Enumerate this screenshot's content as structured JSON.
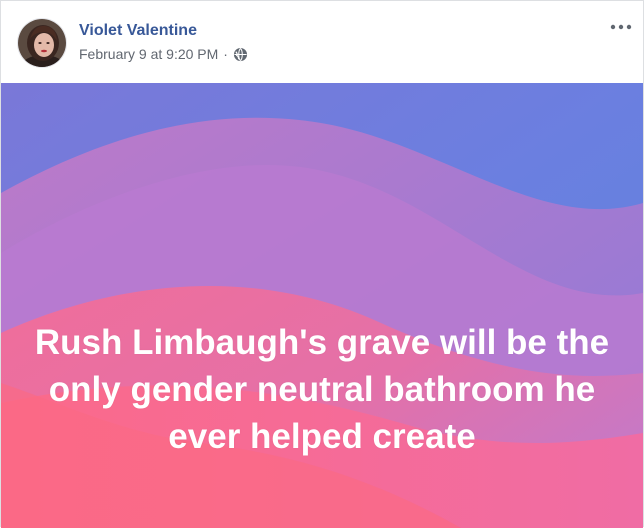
{
  "post": {
    "author": "Violet Valentine",
    "date": "February 9 at 9:20 PM",
    "separator": "·",
    "privacy_icon": "globe-icon",
    "menu_icon": "more-options-icon",
    "text": "Rush Limbaugh's grave will be the only gender neutral bathroom he ever helped create"
  },
  "colors": {
    "author": "#385898",
    "meta": "#616770",
    "bg_top": "#6f7fe0",
    "bg_mid": "#b878d6",
    "bg_bottom": "#f26c9c"
  }
}
